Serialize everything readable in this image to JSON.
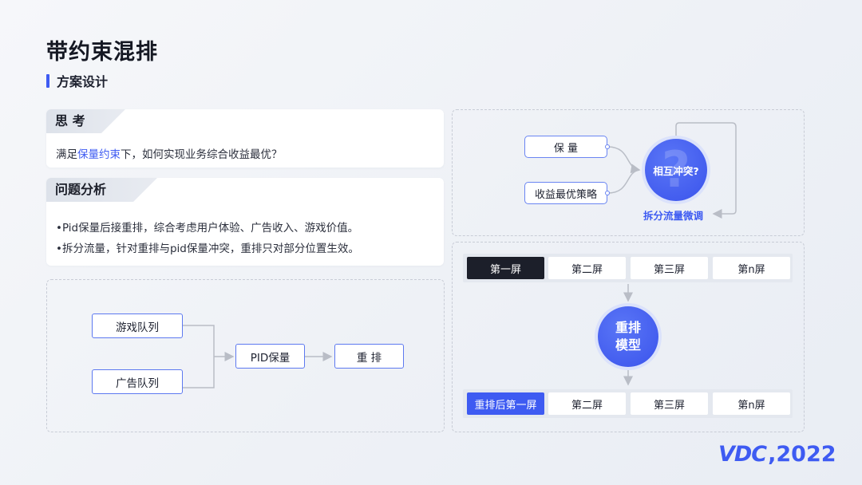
{
  "page": {
    "title": "带约束混排",
    "subtitle": "方案设计"
  },
  "thinking": {
    "tag": "思 考",
    "text_before": "满足",
    "text_highlight": "保量约束",
    "text_after": "下，如何实现业务综合收益最优？"
  },
  "analysis": {
    "tag": "问题分析",
    "bullets": [
      "•Pid保量后接重排，综合考虑用户体验、广告收入、游戏价值。",
      "•拆分流量，针对重排与pid保量冲突，重排只对部分位置生效。"
    ]
  },
  "left_flow": {
    "game_queue": "游戏队列",
    "ad_queue": "广告队列",
    "pid": "PID保量",
    "rerank": "重 排"
  },
  "conflict": {
    "baoliang": "保 量",
    "strategy": "收益最优策略",
    "circle": "相互冲突?",
    "question_mark": "?",
    "caption": "拆分流量微调"
  },
  "screens_top": [
    "第一屏",
    "第二屏",
    "第三屏",
    "第n屏"
  ],
  "rerank_model": {
    "line1": "重排",
    "line2": "模型"
  },
  "screens_bottom": [
    "重排后第一屏",
    "第二屏",
    "第三屏",
    "第n屏"
  ],
  "logo": {
    "letters": "VDC",
    "year": ",2022"
  },
  "colors": {
    "accent": "#3e5bf2",
    "dark_tab": "#1c1f2a",
    "line": "#b9bdc6"
  }
}
